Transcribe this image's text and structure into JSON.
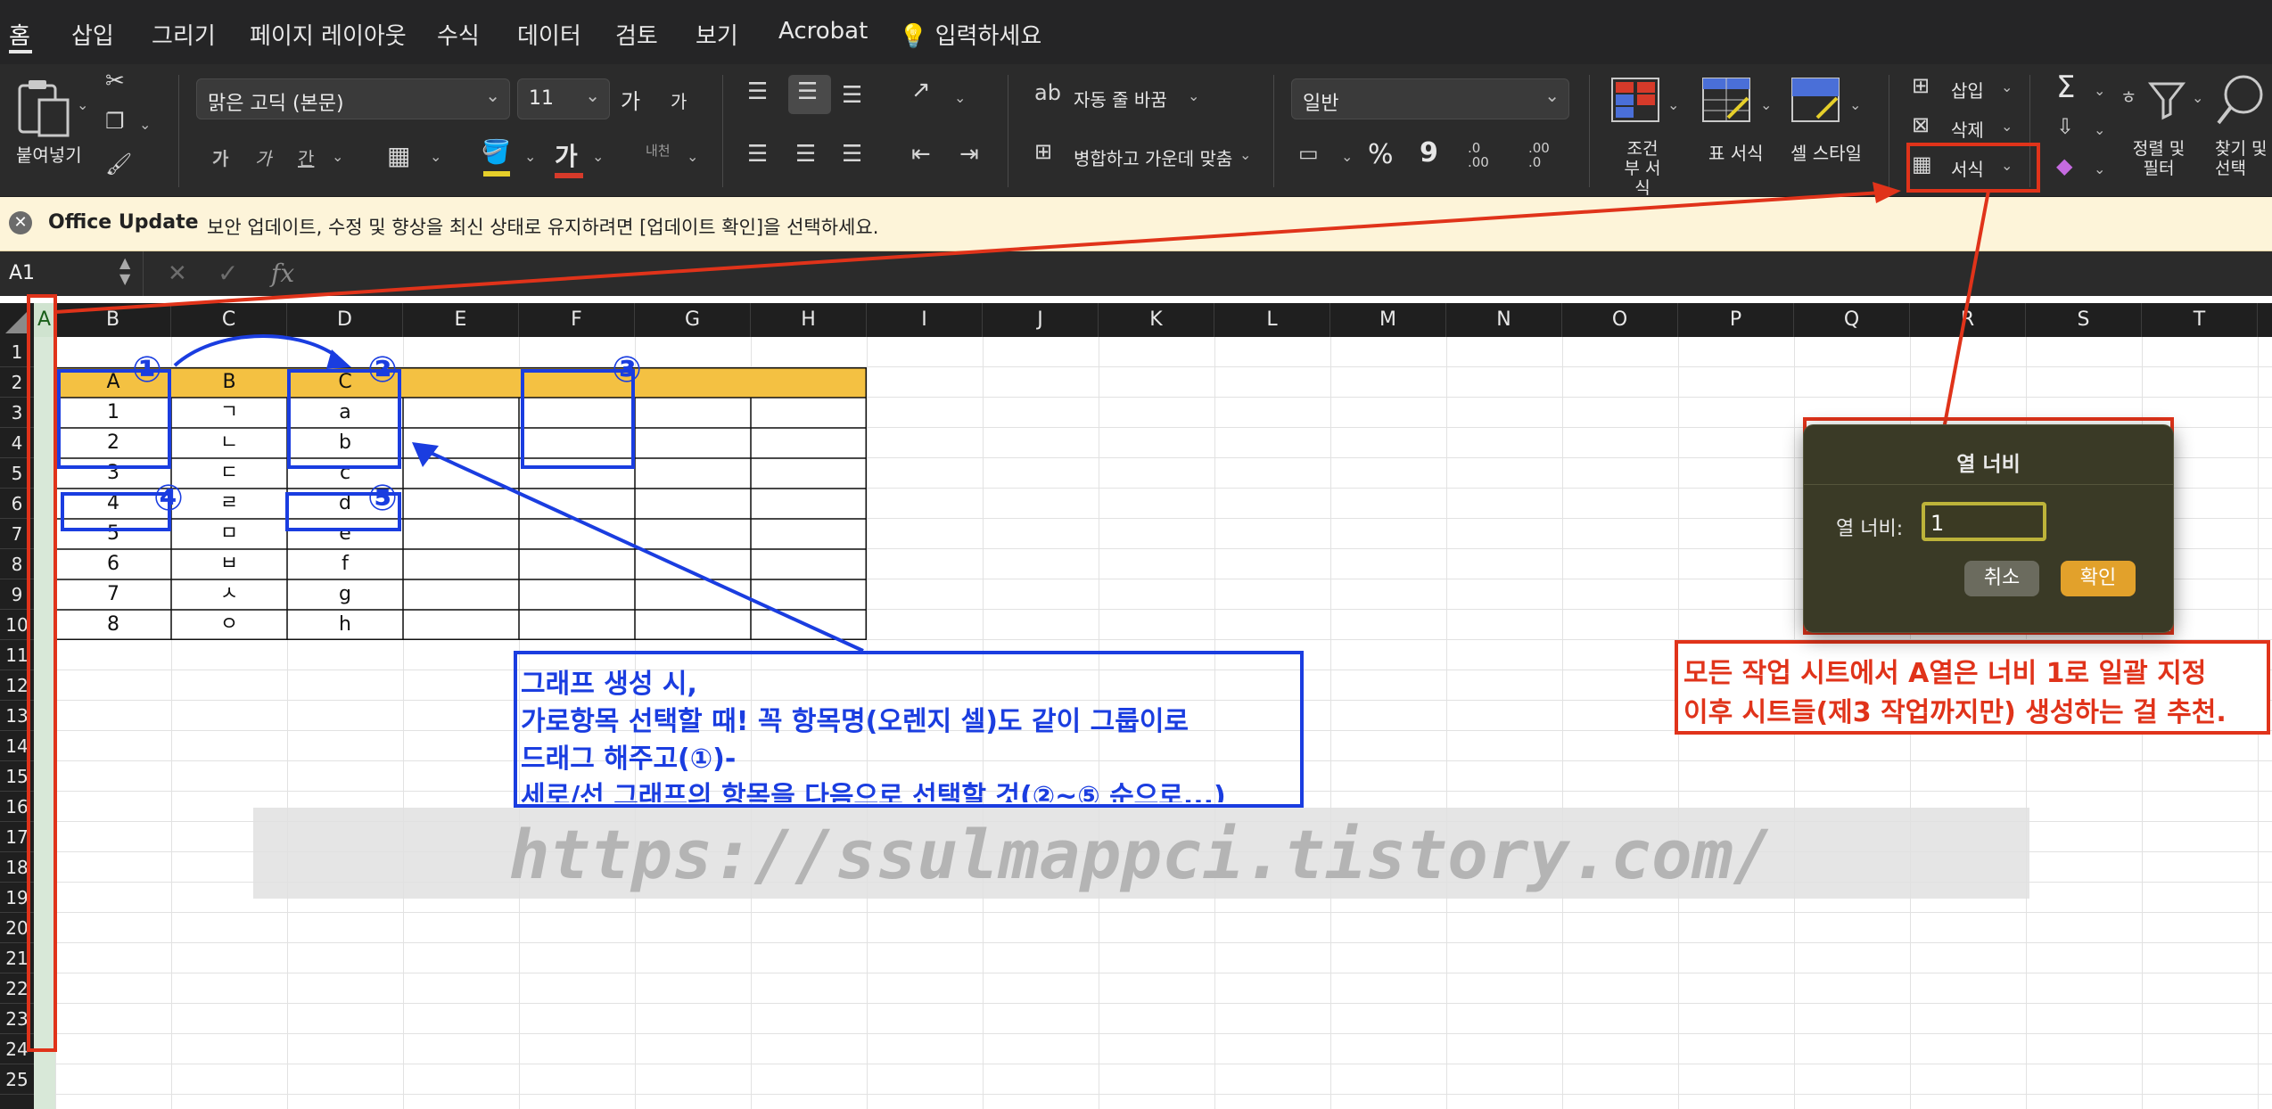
{
  "tabs": [
    {
      "label": "홈",
      "active": true
    },
    {
      "label": "삽입"
    },
    {
      "label": "그리기"
    },
    {
      "label": "페이지 레이아웃"
    },
    {
      "label": "수식"
    },
    {
      "label": "데이터"
    },
    {
      "label": "검토"
    },
    {
      "label": "보기"
    },
    {
      "label": "Acrobat"
    },
    {
      "label": "입력하세요",
      "icon": "lightbulb-icon"
    }
  ],
  "ribbon": {
    "paste_label": "붙여넣기",
    "font_name": "맑은 고딕 (본문)",
    "font_size": "11",
    "grow_font": "가",
    "shrink_font": "가",
    "bold": "가",
    "italic": "가",
    "underline": "간",
    "font_color_glyph": "가",
    "phonetic": "내천",
    "wrap_text": "자동 줄 바꿈",
    "merge_center": "병합하고 가운데 맞춤",
    "number_format": "일반",
    "percent": "%",
    "comma": "9",
    "dec_inc": ".0 .00",
    "dec_dec": ".00 .0",
    "conditional_format": "조건부 서식",
    "table_format": "표 서식",
    "cell_style": "셀 스타일",
    "insert": "삽입",
    "delete": "삭제",
    "format": "서식",
    "sort_filter": "정렬 및 필터",
    "find_select": "찾기 및 선택",
    "sum_symbol": "Σ"
  },
  "notice": {
    "title": "Office Update",
    "message": "보안 업데이트, 수정 및 향상을 최신 상태로 유지하려면 [업데이트 확인]을 선택하세요."
  },
  "formula_bar": {
    "name_box": "A1",
    "fx": "fx",
    "cancel": "✕",
    "confirm": "✓",
    "formula": ""
  },
  "columns": [
    "A",
    "B",
    "C",
    "D",
    "E",
    "F",
    "G",
    "H",
    "I",
    "J",
    "K",
    "L",
    "M",
    "N",
    "O",
    "P",
    "Q",
    "R",
    "S",
    "T"
  ],
  "rows": [
    "1",
    "2",
    "3",
    "4",
    "5",
    "6",
    "7",
    "8",
    "9",
    "10",
    "11",
    "12",
    "13",
    "14",
    "15",
    "16",
    "17",
    "18",
    "19",
    "20",
    "21",
    "22",
    "23",
    "24",
    "25"
  ],
  "table": {
    "headers": [
      "A",
      "B",
      "C"
    ],
    "rows": [
      [
        "1",
        "ㄱ",
        "a"
      ],
      [
        "2",
        "ㄴ",
        "b"
      ],
      [
        "3",
        "ㄷ",
        "c"
      ],
      [
        "4",
        "ㄹ",
        "d"
      ],
      [
        "5",
        "ㅁ",
        "e"
      ],
      [
        "6",
        "ㅂ",
        "f"
      ],
      [
        "7",
        "ㅅ",
        "g"
      ],
      [
        "8",
        "ㅇ",
        "h"
      ]
    ]
  },
  "dialog": {
    "title": "열 너비",
    "field_label": "열 너비:",
    "field_value": "1",
    "cancel": "취소",
    "ok": "확인"
  },
  "annotations": {
    "markers": [
      "①",
      "②",
      "③",
      "④",
      "⑤"
    ],
    "blue_note": [
      "그래프 생성 시,",
      "가로항목 선택할 때! 꼭 항목명(오렌지 셀)도 같이 그룹이로",
      "드래그 해주고(①)-",
      "세로/선 그래프의 항목을 다음으로 선택할 것(②~⑤ 순으로...)"
    ],
    "red_note": [
      "모든 작업 시트에서 A열은 너비 1로 일괄 지정",
      "이후 시트들(제3 작업까지만) 생성하는 걸 추천."
    ]
  },
  "watermark": "https://ssulmappci.tistory.com/",
  "colors": {
    "annotation_blue": "#1a3de0",
    "annotation_red": "#e0331a",
    "header_orange": "#f4c142",
    "ok_button": "#e2a12b"
  }
}
